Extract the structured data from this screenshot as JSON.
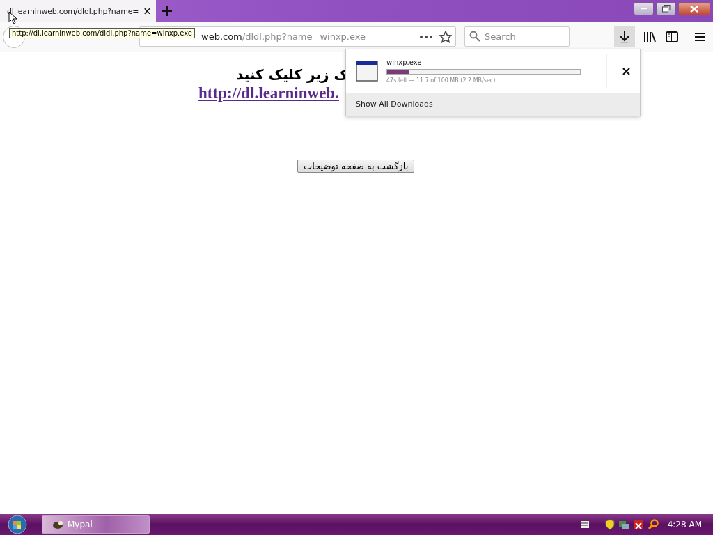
{
  "tab": {
    "title": "dl.learninweb.com/dldl.php?name=",
    "selected": true
  },
  "tooltip": "http://dl.learninweb.com/dldl.php?name=winxp.exe",
  "address": {
    "domain": "web.com",
    "path": "/dldl.php?name=winxp.exe"
  },
  "search": {
    "placeholder": "Search"
  },
  "downloads_panel": {
    "items": [
      {
        "name": "winxp.exe",
        "level": 0.115,
        "status": "47s left — 11.7 of 100 MB (2.2 MB/sec)"
      }
    ],
    "footer": "Show All Downloads"
  },
  "page": {
    "heading": "ک زیر کلیک کنید",
    "link": "http://dl.learninweb.",
    "button": "بازگشت به صفحه توضیحات"
  },
  "taskbar": {
    "apps": [
      {
        "label": "Mypal",
        "selected": true
      }
    ],
    "clock": "4:28 AM"
  }
}
